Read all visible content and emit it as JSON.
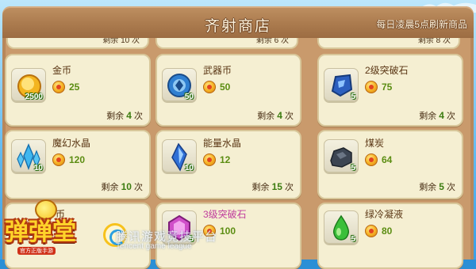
{
  "header": {
    "title": "齐射商店",
    "refresh_note": "每日凌晨5点刷新商品"
  },
  "top_strips": [
    {
      "remain": "剩余 10 次"
    },
    {
      "remain": "剩余 6 次"
    },
    {
      "remain": "剩余 8 次"
    }
  ],
  "items": [
    {
      "name": "金币",
      "qty": "2500",
      "price": "25",
      "remain_label": "剩余",
      "remain_count": "4",
      "remain_unit": "次",
      "icon": "gold-coin-icon"
    },
    {
      "name": "武器币",
      "qty": "50",
      "price": "50",
      "remain_label": "剩余",
      "remain_count": "4",
      "remain_unit": "次",
      "icon": "weapon-coin-icon"
    },
    {
      "name": "2级突破石",
      "qty": "5",
      "price": "75",
      "remain_label": "剩余",
      "remain_count": "4",
      "remain_unit": "次",
      "icon": "breakthrough-stone-lv2-icon"
    },
    {
      "name": "魔幻水晶",
      "qty": "10",
      "price": "120",
      "remain_label": "剩余",
      "remain_count": "10",
      "remain_unit": "次",
      "icon": "magic-crystal-icon"
    },
    {
      "name": "能量水晶",
      "qty": "10",
      "price": "12",
      "remain_label": "剩余",
      "remain_count": "15",
      "remain_unit": "次",
      "icon": "energy-crystal-icon"
    },
    {
      "name": "煤炭",
      "qty": "5",
      "price": "64",
      "remain_label": "剩余",
      "remain_count": "5",
      "remain_unit": "次",
      "icon": "coal-icon"
    },
    {
      "name": "币",
      "qty": "",
      "price": "",
      "remain_label": "",
      "remain_count": "",
      "remain_unit": "",
      "icon": "hidden-item-icon"
    },
    {
      "name": "3级突破石",
      "qty": "5",
      "price": "100",
      "remain_label": "",
      "remain_count": "",
      "remain_unit": "",
      "icon": "breakthrough-stone-lv3-icon"
    },
    {
      "name": "绿冷凝液",
      "qty": "5",
      "price": "80",
      "remain_label": "",
      "remain_count": "",
      "remain_unit": "",
      "icon": "green-condensate-icon"
    }
  ],
  "logo": {
    "title": "弹弹堂",
    "subtitle": "官方正版手游"
  },
  "watermark": {
    "line1": "腾讯游戏竞技平台",
    "line2": "Tencent game league"
  },
  "colors": {
    "header": "#ab7b4e",
    "card_bg": "#f5efd2",
    "price_green": "#5b8d12"
  }
}
